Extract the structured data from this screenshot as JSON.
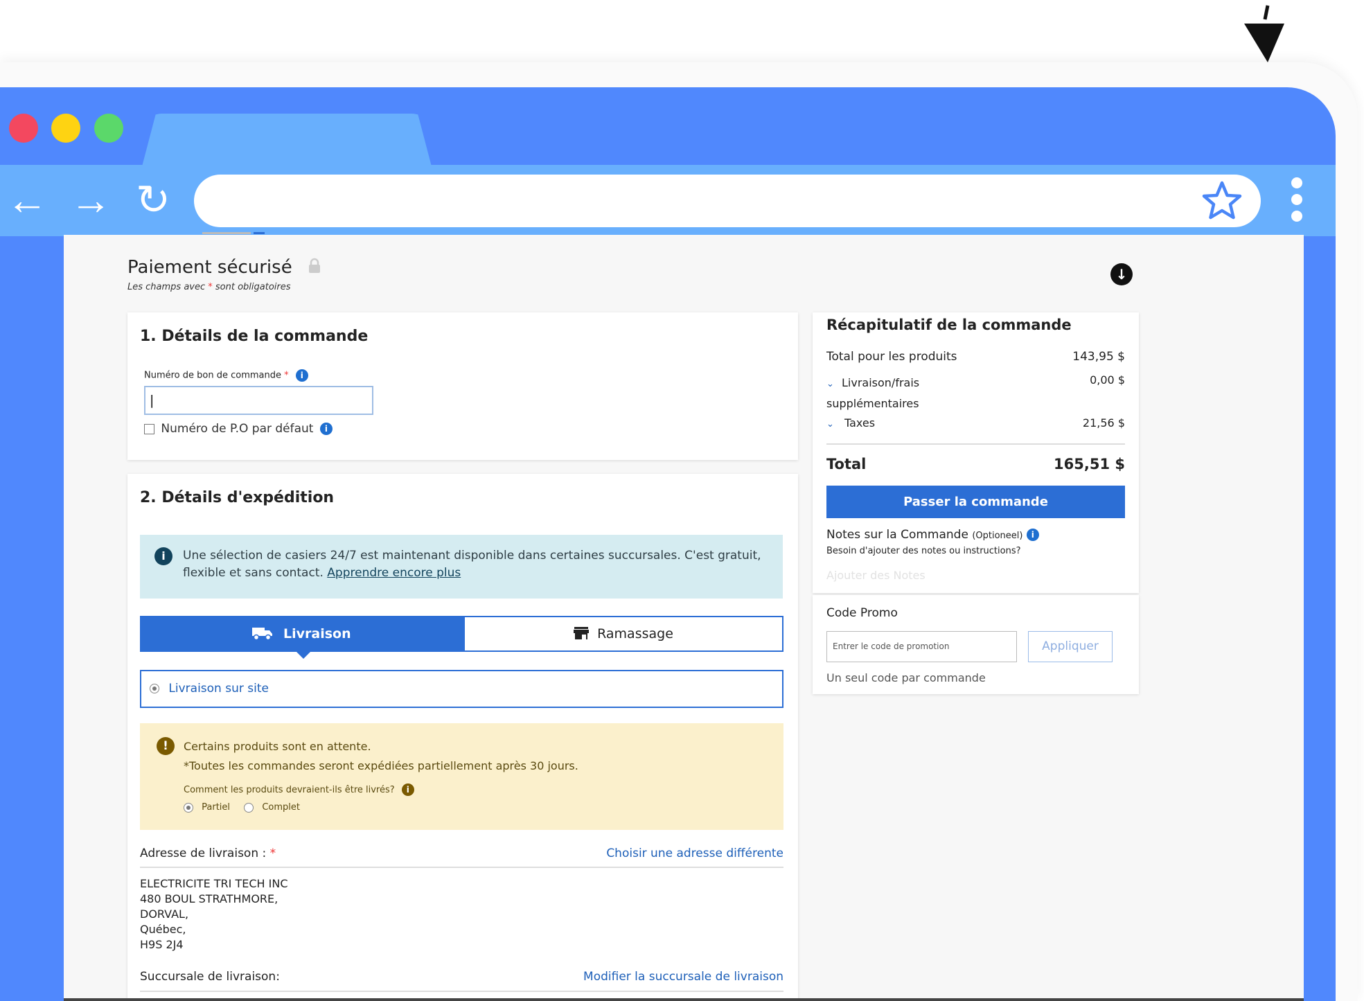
{
  "browser": {
    "window_controls": {
      "close_color": "#f3485f",
      "minimize_color": "#fed312",
      "maximize_color": "#5bd86a"
    },
    "accent": "#5088fd",
    "toolbar_color": "#68affd",
    "icons": {
      "back": "←",
      "forward": "→",
      "reload": "↻"
    }
  },
  "header": {
    "title": "Paiement sécurisé",
    "required_prefix": "Les champs avec",
    "required_star": "*",
    "required_suffix": "sont obligatoires"
  },
  "order_details": {
    "title": "1. Détails de la commande",
    "po_label": "Numéro de bon de commande",
    "po_value": "|",
    "default_po_label": "Numéro de P.O par défaut"
  },
  "shipping": {
    "title": "2. Détails d'expédition",
    "info_text": "Une sélection de casiers 24/7 est maintenant disponible dans certaines succursales. C'est gratuit, flexible et sans contact.",
    "info_link": "Apprendre encore plus",
    "tabs": {
      "delivery": "Livraison",
      "pickup": "Ramassage"
    },
    "delivery_option": "Livraison sur site",
    "warning_line1": "Certains produits sont en attente.",
    "warning_line2": "*Toutes les commandes seront expédiées partiellement après 30 jours.",
    "warning_question": "Comment les produits devraient-ils être livrés?",
    "option_partial": "Partiel",
    "option_complete": "Complet",
    "address_label": "Adresse de livraison :",
    "address_link": "Choisir une adresse différente",
    "address_lines": [
      "ELECTRICITE TRI TECH INC",
      "480 BOUL STRATHMORE,",
      "DORVAL,",
      "Québec,",
      "H9S 2J4"
    ],
    "branch_label": "Succursale de livraison:",
    "branch_link": "Modifier la succursale de livraison"
  },
  "summary": {
    "title": "Récapitulatif de la commande",
    "products_label": "Total pour les produits",
    "products_amount": "143,95 $",
    "shipping_label_1": "Livraison/frais",
    "shipping_label_2": "supplémentaires",
    "shipping_amount": "0,00 $",
    "taxes_label": "Taxes",
    "taxes_amount": "21,56 $",
    "total_label": "Total",
    "total_amount": "165,51 $",
    "place_order": "Passer la commande",
    "notes_title": "Notes sur la Commande",
    "notes_optional": "(Optioneel)",
    "notes_help": "Besoin d'ajouter des notes ou instructions?",
    "notes_placeholder": "Ajouter des Notes"
  },
  "promo": {
    "title": "Code Promo",
    "placeholder": "Entrer le code de promotion",
    "apply": "Appliquer",
    "hint": "Un seul code par commande"
  }
}
